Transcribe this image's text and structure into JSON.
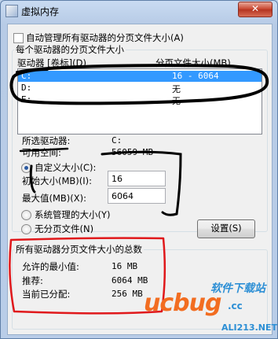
{
  "window": {
    "title": "虚拟内存",
    "close_glyph": "✕"
  },
  "auto_manage": {
    "label": "自动管理所有驱动器的分页文件大小(A)",
    "checked": false
  },
  "per_drive_group": {
    "legend": "每个驱动器的分页文件大小"
  },
  "drive_list": {
    "header_drive": "驱动器 [卷标](D)",
    "header_size": "分页文件大小(MB)",
    "rows": [
      {
        "drive": "C:",
        "size": "16 - 6064",
        "selected": true
      },
      {
        "drive": "D:",
        "size": "无",
        "selected": false
      },
      {
        "drive": "E:",
        "size": "无",
        "selected": false
      }
    ]
  },
  "selected_drive": {
    "label": "所选驱动器:",
    "value": "C:",
    "space_label": "可用空间:",
    "space_value": "56059 MB"
  },
  "custom_size": {
    "label": "自定义大小(C):",
    "checked": true,
    "initial_label": "初始大小(MB)(I):",
    "initial_value": "16",
    "max_label": "最大值(MB)(X):",
    "max_value": "6064"
  },
  "system_managed": {
    "label": "系统管理的大小(Y)",
    "checked": false
  },
  "no_paging": {
    "label": "无分页文件(N)",
    "checked": false
  },
  "set_button": {
    "label": "设置(S)"
  },
  "totals_group": {
    "legend": "所有驱动器分页文件大小的总数",
    "min_label": "允许的最小值:",
    "min_value": "16 MB",
    "recommended_label": "推荐:",
    "recommended_value": "6064 MB",
    "current_label": "当前已分配:",
    "current_value": "256 MB"
  },
  "watermark": {
    "brand": "ucbug",
    "brand_suffix": ".cc",
    "tagline": "软件下载站",
    "url": "ALI213.NET"
  },
  "colors": {
    "annotation_black": "#000000",
    "annotation_red": "#e0181b",
    "selection": "#3399ff"
  }
}
